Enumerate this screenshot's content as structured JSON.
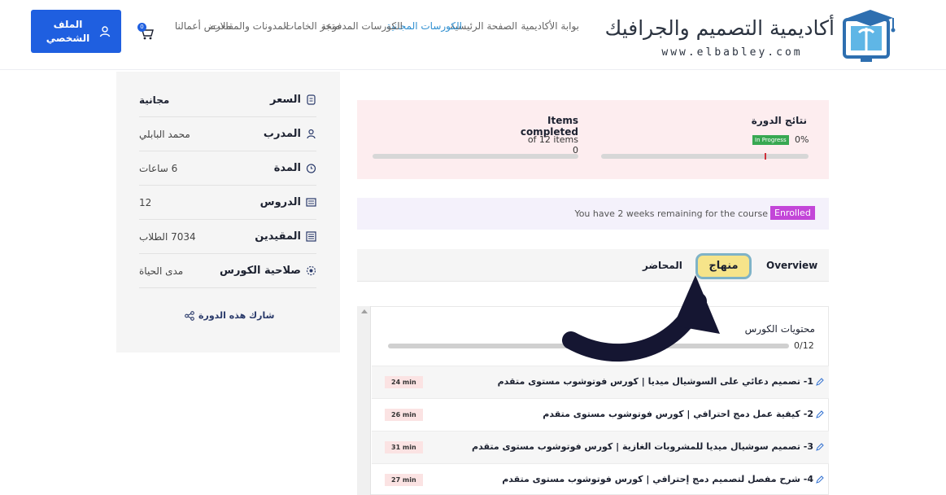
{
  "header": {
    "profile_button": "الملف الشخصي",
    "cart_count": "0",
    "nav": [
      {
        "label": "بوابة الأكاديمية",
        "active": false
      },
      {
        "label": "الصفحة الرئيسية",
        "active": false
      },
      {
        "label": "الكورسات المجانية",
        "active": true
      },
      {
        "label": "الكورسات المدفوعة",
        "active": false
      },
      {
        "label": "متجر الخامات",
        "active": false
      },
      {
        "label": "المدونات والمقالات",
        "active": false
      },
      {
        "label": "معرض أعمالنا",
        "active": false
      }
    ],
    "logo_title": "أكاديمية التصميم والجرافيك",
    "logo_url": "www.elbabley.com"
  },
  "sidebar": {
    "rows": [
      {
        "label": "السعر",
        "value": "مجانية",
        "icon": "price-tag-icon"
      },
      {
        "label": "المدرب",
        "value": "محمد البابلي",
        "icon": "instructor-icon"
      },
      {
        "label": "المدة",
        "value": "6 ساعات",
        "icon": "clock-icon"
      },
      {
        "label": "الدروس",
        "value": "12",
        "icon": "lessons-icon"
      },
      {
        "label": "المقيدين",
        "value": "7034 الطلاب",
        "icon": "students-icon"
      },
      {
        "label": "صلاحية الكورس",
        "value": "مدى الحياة",
        "icon": "validity-icon"
      }
    ],
    "share_label": "شارك هذه الدورة"
  },
  "results": {
    "title": "نتائج الدورة",
    "status_badge": "In Progress",
    "percent": "0%",
    "progress_fraction": 0,
    "items_title": "Items completed",
    "items_text": "of 12 items 0"
  },
  "enrollment": {
    "text": "You have 2 weeks remaining for the course",
    "badge": "Enrolled"
  },
  "tabs": {
    "overview": "Overview",
    "curriculum": "منهاج",
    "instructor": "المحاضر"
  },
  "curriculum": {
    "title": "محتويات الكورس",
    "count": "0/12",
    "lessons": [
      {
        "title": "1- تصميم دعائي على السوشيال ميديا | كورس فوتوشوب مستوى متقدم",
        "duration": "24 min"
      },
      {
        "title": "2- كيفية عمل دمج احترافي | كورس فوتوشوب مستوى متقدم",
        "duration": "26 min"
      },
      {
        "title": "3- تصميم سوشيال ميديا للمشروبات الغازية | كورس فوتوشوب مستوى متقدم",
        "duration": "31 min"
      },
      {
        "title": "4- شرح مفصل لتصميم دمج إحترافي | كورس فوتوشوب مستوى متقدم",
        "duration": "27 min"
      }
    ]
  },
  "colors": {
    "primary": "#1f5fe0",
    "active_nav": "#2f8fd0",
    "progress_badge": "#38a852",
    "enrolled_badge": "#c346d8",
    "highlight_tab": "#f6e48a",
    "arrow": "#151632"
  }
}
